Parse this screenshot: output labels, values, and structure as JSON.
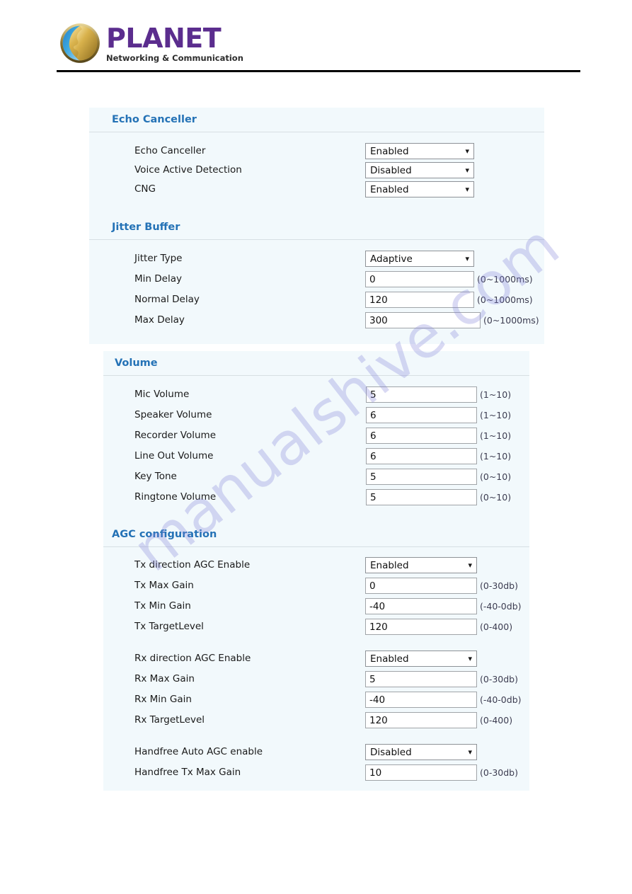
{
  "header": {
    "brand": "PLANET",
    "tagline": "Networking & Communication",
    "logo_icon": "planet-globe-logo"
  },
  "watermark": {
    "text": "manualshive.com"
  },
  "sections": [
    {
      "id": "echo-canceller",
      "title": "Echo Canceller",
      "rows": [
        {
          "label": "Echo Canceller",
          "control": "select",
          "value": "Enabled",
          "hint": ""
        },
        {
          "label": "Voice Active Detection",
          "control": "select",
          "value": "Disabled",
          "hint": ""
        },
        {
          "label": "CNG",
          "control": "select",
          "value": "Enabled",
          "hint": ""
        }
      ]
    },
    {
      "id": "jitter-buffer",
      "title": "Jitter Buffer",
      "rows": [
        {
          "label": "Jitter Type",
          "control": "select",
          "value": "Adaptive",
          "hint": ""
        },
        {
          "label": "Min Delay",
          "control": "input",
          "value": "0",
          "hint": "(0~1000ms)"
        },
        {
          "label": "Normal Delay",
          "control": "input",
          "value": "120",
          "hint": "(0~1000ms)"
        },
        {
          "label": "Max Delay",
          "control": "input",
          "value": "300",
          "hint": "(0~1000ms)"
        }
      ]
    },
    {
      "id": "volume",
      "title": "Volume",
      "rows": [
        {
          "label": "Mic Volume",
          "control": "input",
          "value": "5",
          "hint": "(1~10)"
        },
        {
          "label": "Speaker Volume",
          "control": "input",
          "value": "6",
          "hint": "(1~10)"
        },
        {
          "label": "Recorder Volume",
          "control": "input",
          "value": "6",
          "hint": "(1~10)"
        },
        {
          "label": "Line Out Volume",
          "control": "input",
          "value": "6",
          "hint": "(1~10)"
        },
        {
          "label": "Key Tone",
          "control": "input",
          "value": "5",
          "hint": "(0~10)"
        },
        {
          "label": "Ringtone Volume",
          "control": "input",
          "value": "5",
          "hint": "(0~10)"
        }
      ]
    },
    {
      "id": "agc-configuration",
      "title": "AGC configuration",
      "rows": [
        {
          "label": "Tx direction AGC Enable",
          "control": "select",
          "value": "Enabled",
          "hint": ""
        },
        {
          "label": "Tx Max Gain",
          "control": "input",
          "value": "0",
          "hint": "(0-30db)"
        },
        {
          "label": "Tx Min Gain",
          "control": "input",
          "value": "-40",
          "hint": "(-40-0db)"
        },
        {
          "label": "Tx TargetLevel",
          "control": "input",
          "value": "120",
          "hint": "(0-400)"
        },
        {
          "label": "Rx direction AGC Enable",
          "control": "select",
          "value": "Enabled",
          "hint": ""
        },
        {
          "label": "Rx Max Gain",
          "control": "input",
          "value": "5",
          "hint": "(0-30db)"
        },
        {
          "label": "Rx Min Gain",
          "control": "input",
          "value": "-40",
          "hint": "(-40-0db)"
        },
        {
          "label": "Rx TargetLevel",
          "control": "input",
          "value": "120",
          "hint": "(0-400)"
        },
        {
          "label": "Handfree Auto AGC enable",
          "control": "select",
          "value": "Disabled",
          "hint": ""
        },
        {
          "label": "Handfree Tx Max Gain",
          "control": "input",
          "value": "10",
          "hint": "(0-30db)"
        }
      ]
    }
  ],
  "icons": {
    "chevron_down": "⌄"
  },
  "colors": {
    "section_title": "#2472b6",
    "panel_bg": "#f2f9fc",
    "brand_purple": "#5b2d8e",
    "watermark": "#8181d6"
  }
}
